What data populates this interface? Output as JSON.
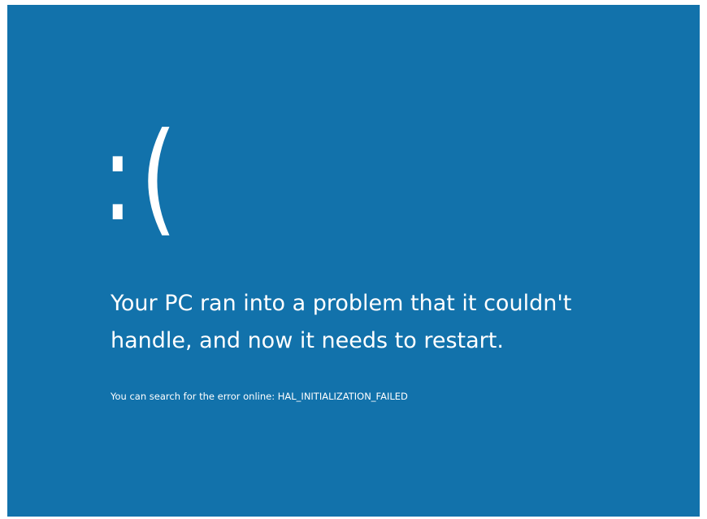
{
  "screen": {
    "background_color": "#1272ab",
    "text_color": "#ffffff"
  },
  "emoticon": ":(",
  "message": {
    "line1": "Your PC ran into a problem that it couldn't",
    "line2": "handle, and now it needs to restart."
  },
  "error_hint": {
    "prefix": "You can search for the error online: ",
    "code": "HAL_INITIALIZATION_FAILED"
  }
}
